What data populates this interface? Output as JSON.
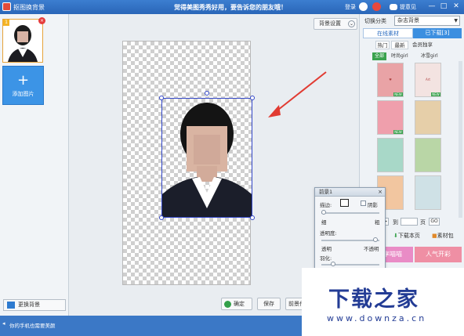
{
  "titlebar": {
    "app_title": "抠图换背景",
    "slogan": "觉得美图秀秀好用，要告诉您的朋友哦！",
    "login": "登录",
    "feedback": "提意见"
  },
  "left": {
    "add_image": "添加图片",
    "change_bg": "更换背景"
  },
  "canvas": {
    "bg_settings": "背景设置",
    "confirm": "确定",
    "save": "保存",
    "fg_btn": "前景作"
  },
  "right": {
    "switch_category": "切换分类",
    "category_value": "杂志背景",
    "tabs": [
      "在线素材",
      "已下载[3]"
    ],
    "subtabs": [
      "热门",
      "最新",
      "会员独享"
    ],
    "filters": [
      "全部",
      "时尚girl",
      "冰雪girl"
    ],
    "pager_to": "到",
    "pager_page": "页",
    "pager_go": "GO",
    "download_page": "下载本页",
    "material_pack": "素材包",
    "banners": [
      "享喵喵",
      "人气开彩"
    ]
  },
  "fg_panel": {
    "title": "前景1",
    "border": "描边:",
    "shadow": "阴影",
    "thin": "细",
    "thick": "粗",
    "opacity": "透明度:",
    "transparent": "透明",
    "opaque": "不透明",
    "feather": "羽化:"
  },
  "status": {
    "message": "你的手机也需要美颜"
  },
  "watermark": {
    "brand": "下载之家",
    "url": "www.downza.cn"
  },
  "colors": {
    "accent": "#3c8fe0",
    "titlebar": "#2a66b8",
    "selection": "#3246c8"
  }
}
